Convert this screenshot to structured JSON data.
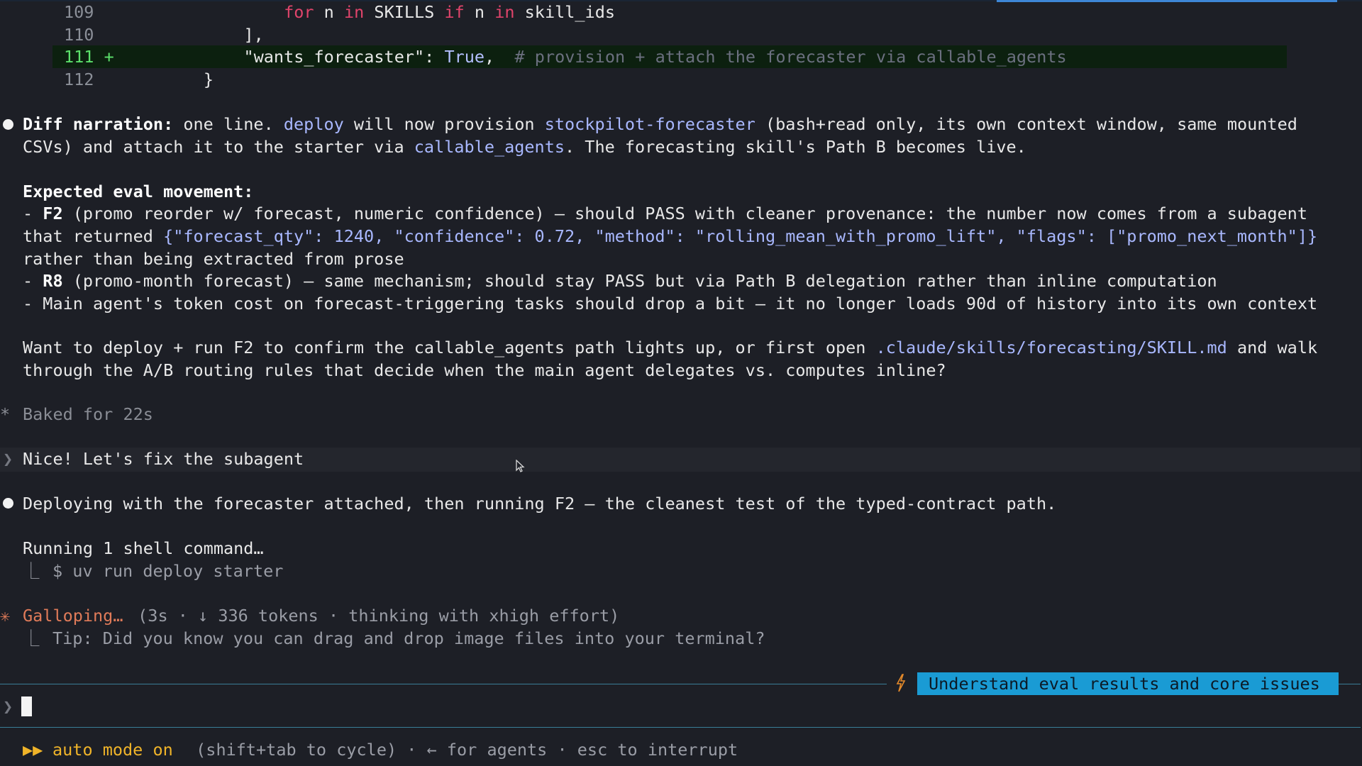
{
  "diff": {
    "rows": [
      {
        "num": "109",
        "parts": [
          {
            "t": "              "
          },
          {
            "t": "for",
            "c": "kw"
          },
          {
            "t": " n "
          },
          {
            "t": "in",
            "c": "kw"
          },
          {
            "t": " SKILLS "
          },
          {
            "t": "if",
            "c": "kw"
          },
          {
            "t": " n "
          },
          {
            "t": "in",
            "c": "kw"
          },
          {
            "t": " skill_ids"
          }
        ]
      },
      {
        "num": "110",
        "parts": [
          {
            "t": "          ],"
          }
        ]
      },
      {
        "num": "111 +",
        "parts": [
          {
            "t": "          \"wants_forecaster\": "
          },
          {
            "t": "True",
            "c": "bool"
          },
          {
            "t": ",  "
          },
          {
            "t": "# provision + attach the forecaster via callable_agents",
            "c": "cm"
          }
        ]
      },
      {
        "num": "112",
        "parts": [
          {
            "t": "      }"
          }
        ]
      }
    ]
  },
  "narration": {
    "label": "Diff narration:",
    "l1_a": " one line. ",
    "l1_code1": "deploy",
    "l1_b": " will now provision ",
    "l1_code2": "stockpilot-forecaster",
    "l1_c": " (bash+read only, its own context window, same mounted",
    "l2_a": "CSVs) and attach it to the starter via ",
    "l2_code": "callable_agents",
    "l2_b": ". The forecasting skill's Path B becomes live."
  },
  "eval": {
    "heading": "Expected eval movement:",
    "f2_dash": "- ",
    "f2_label": "F2",
    "f2_text": " (promo reorder w/ forecast, numeric confidence) — should PASS with cleaner provenance: the number now comes from a subagent",
    "f2_l2_a": "that returned ",
    "f2_l2_code": "{\"forecast_qty\": 1240, \"confidence\": 0.72, \"method\": \"rolling_mean_with_promo_lift\", \"flags\": [\"promo_next_month\"]}",
    "f2_l3": "rather than being extracted from prose",
    "r8_dash": "- ",
    "r8_label": "R8",
    "r8_text": " (promo-month forecast) — same mechanism; should stay PASS but via Path B delegation rather than inline computation",
    "main_line": "- Main agent's token cost on forecast-triggering tasks should drop a bit — it no longer loads 90d of history into its own context"
  },
  "question": {
    "l1_a": "Want to deploy + run F2 to confirm the callable_agents path lights up, or first open ",
    "l1_code": ".claude/skills/forecasting/SKILL.md",
    "l1_b": " and walk",
    "l2": "through the A/B routing rules that decide when the main agent delegates vs. computes inline?"
  },
  "baked": {
    "icon": "*",
    "text": "Baked for 22s"
  },
  "user_message": {
    "prompt": "❯",
    "text": "Nice! Let's fix the subagent"
  },
  "deploy_message": "Deploying with the forecaster attached, then running F2 — the cleanest test of the typed-contract path.",
  "running": {
    "title": "Running 1 shell command…",
    "branch": "⎿",
    "command": "$ uv run deploy starter"
  },
  "status": {
    "icon": "✳",
    "word": "Galloping…",
    "detail": " (3s · ↓ 336 tokens · thinking with xhigh effort)",
    "tip": "Tip: Did you know you can drag and drop image files into your terminal?"
  },
  "suggestion": {
    "icon": "lightning-icon",
    "text": "Understand eval results and core issues"
  },
  "input": {
    "prompt": "❯",
    "value": ""
  },
  "footer": {
    "icon": "▶▶",
    "mode": "auto mode on",
    "hints": " (shift+tab to cycle) · ← for agents · esc to interrupt"
  },
  "colors": {
    "background": "#1d1f26",
    "keyword": "#e0446b",
    "code": "#a9b8ff",
    "accent_orange": "#e07b59",
    "accent_gold": "#f0b429",
    "suggestion_bg": "#1a9bd4"
  }
}
